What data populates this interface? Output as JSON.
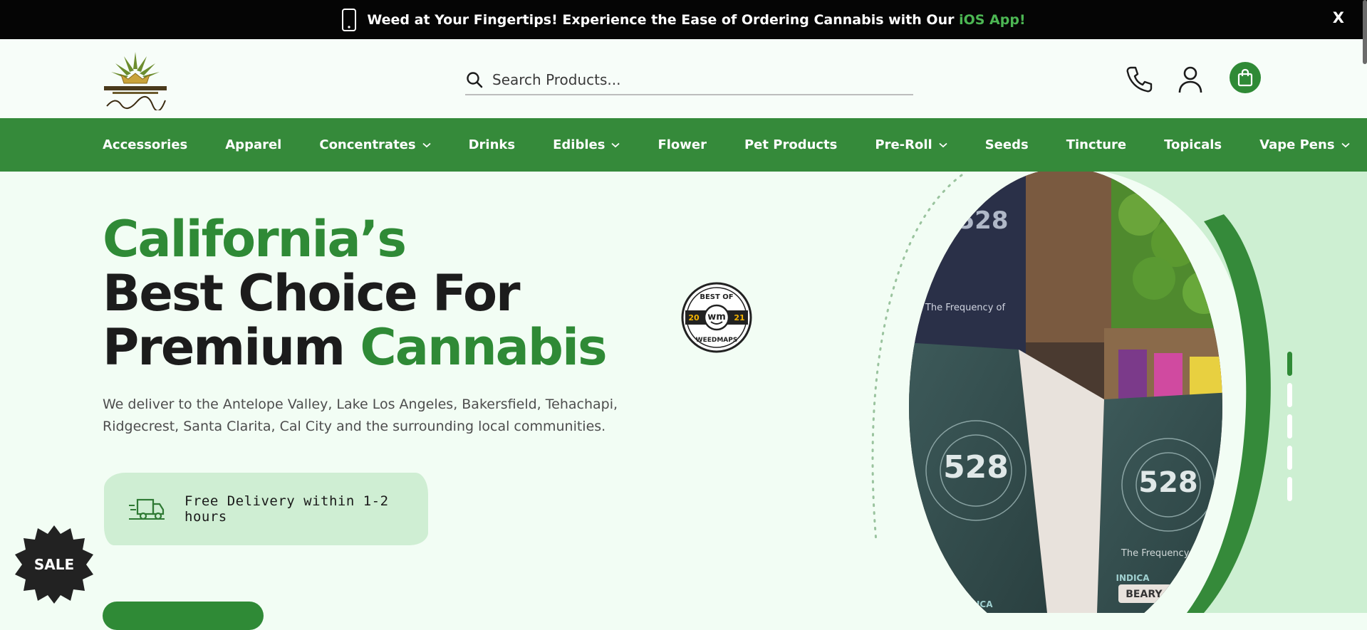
{
  "announcement": {
    "text": "Weed at Your Fingertips! Experience the Ease of Ordering Cannabis with Our",
    "highlight": "iOS App!",
    "close_label": "X"
  },
  "header": {
    "logo_icon": "royal-apothecary-logo",
    "search_placeholder": "Search Products..."
  },
  "nav": {
    "items": [
      {
        "label": "Accessories",
        "dropdown": false
      },
      {
        "label": "Apparel",
        "dropdown": false
      },
      {
        "label": "Concentrates",
        "dropdown": true
      },
      {
        "label": "Drinks",
        "dropdown": false
      },
      {
        "label": "Edibles",
        "dropdown": true
      },
      {
        "label": "Flower",
        "dropdown": false
      },
      {
        "label": "Pet Products",
        "dropdown": false
      },
      {
        "label": "Pre-Roll",
        "dropdown": true
      },
      {
        "label": "Seeds",
        "dropdown": false
      },
      {
        "label": "Tincture",
        "dropdown": false
      },
      {
        "label": "Topicals",
        "dropdown": false
      },
      {
        "label": "Vape Pens",
        "dropdown": true
      }
    ]
  },
  "hero": {
    "line1": "California’s",
    "line2": "Best Choice For",
    "line3a": "Premium",
    "line3b": "Cannabis",
    "description": "We deliver to the Antelope Valley, Lake Los Angeles, Bakersfield, Tehachapi, Ridgecrest, Santa Clarita, Cal City and the surrounding local communities.",
    "delivery_text": "Free Delivery within 1-2 hours",
    "badge": {
      "top": "BEST OF",
      "bottom": "WEEDMAPS",
      "left": "20",
      "right": "21",
      "center": "wm"
    },
    "image_texts": {
      "brand": "528",
      "tagline": "The Frequency of",
      "strain": "BEARY OG",
      "type": "INDICA"
    }
  },
  "sale_label": "SALE",
  "colors": {
    "brand_green": "#358a3a",
    "light_green": "#cfeed3",
    "bg": "#f2fdf4",
    "dark": "#1c1c1c"
  }
}
